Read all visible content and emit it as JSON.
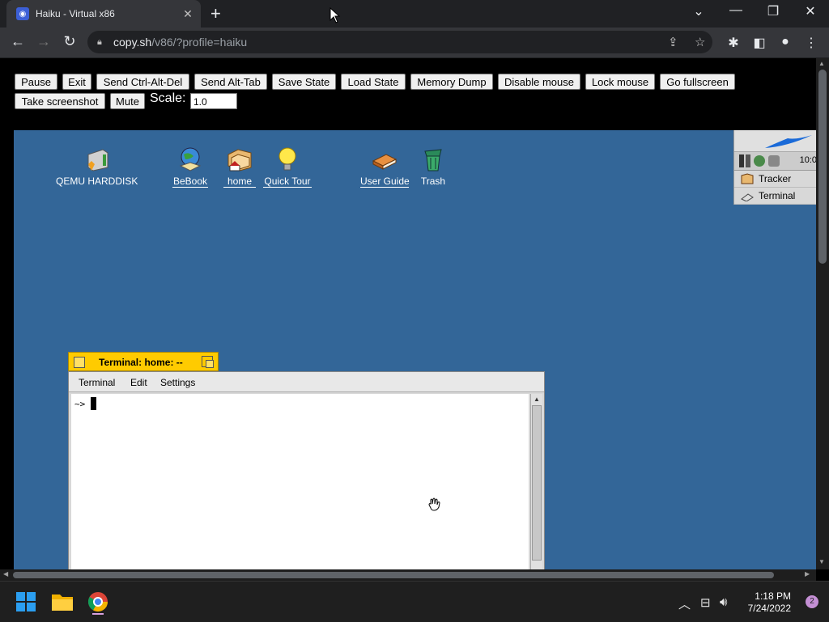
{
  "browser": {
    "tab_title": "Haiku - Virtual x86",
    "tab_close": "✕",
    "new_tab": "+",
    "window_controls": {
      "menu": "⌄",
      "minimize": "—",
      "restore": "❐",
      "close": "✕"
    },
    "nav": {
      "back": "←",
      "forward": "→",
      "reload": "↻"
    },
    "url_host": "copy.sh",
    "url_path": "/v86/?profile=haiku"
  },
  "v86": {
    "buttons": [
      "Pause",
      "Exit",
      "Send Ctrl-Alt-Del",
      "Send Alt-Tab",
      "Save State",
      "Load State",
      "Memory Dump",
      "Disable mouse",
      "Lock mouse",
      "Go fullscreen"
    ],
    "buttons_row2": [
      "Take screenshot",
      "Mute"
    ],
    "scale_label": "Scale:",
    "scale_value": "1.0"
  },
  "haiku": {
    "desktop_icons": [
      {
        "label": "QEMU HARDDISK",
        "icon": "harddisk-icon"
      },
      {
        "label": "BeBook",
        "icon": "globe-book-icon"
      },
      {
        "label": "home",
        "icon": "home-folder-icon"
      },
      {
        "label": "Quick Tour",
        "icon": "lightbulb-icon"
      },
      {
        "label": "User Guide",
        "icon": "book-icon"
      },
      {
        "label": "Trash",
        "icon": "trash-icon"
      }
    ],
    "deskbar": {
      "clock": "10:0",
      "items": [
        "Tracker",
        "Terminal"
      ]
    },
    "terminal": {
      "tab_title": "Terminal: home: --",
      "menu": [
        "Terminal",
        "Edit",
        "Settings"
      ],
      "prompt": "~>"
    }
  },
  "taskbar": {
    "time": "1:18 PM",
    "date": "7/24/2022",
    "notifications": "2",
    "colors": {
      "accent": "#0078d4",
      "desktop": "#336698",
      "terminal_tab": "#ffcb00"
    }
  }
}
